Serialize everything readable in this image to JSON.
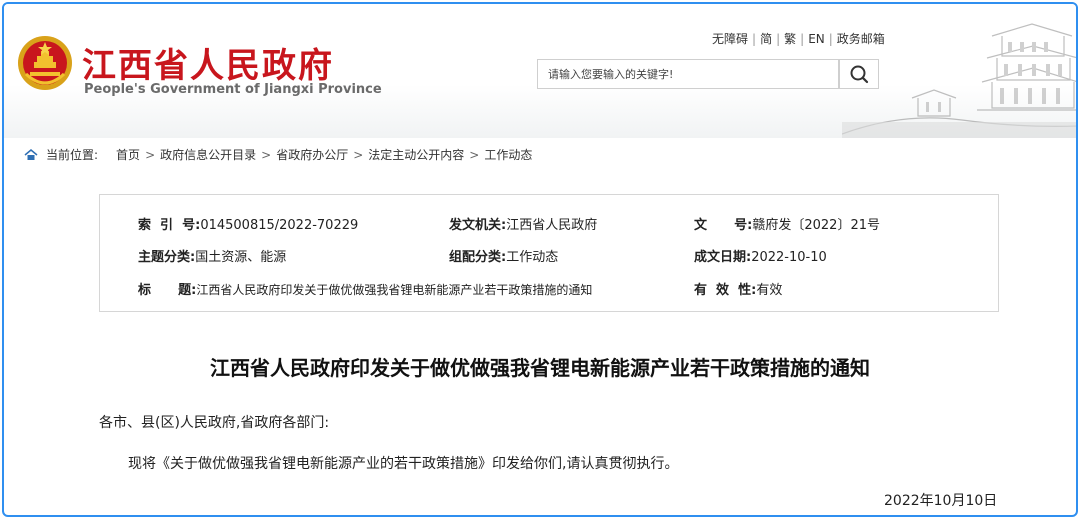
{
  "header": {
    "title_cn": "江西省人民政府",
    "title_en": "People's Government of Jiangxi Province",
    "links": [
      "无障碍",
      "简",
      "繁",
      "EN",
      "政务邮箱"
    ],
    "search": {
      "placeholder": "请输入您要输入的关键字!"
    },
    "emblem_icon": "national-emblem-icon",
    "search_icon": "magnifier-icon",
    "decoration": "tengwang-pavilion-illustration"
  },
  "breadcrumb": {
    "position_label": "当前位置:",
    "items": [
      "首页",
      "政府信息公开目录",
      "省政府办公厅",
      "法定主动公开内容",
      "工作动态"
    ]
  },
  "info": {
    "index_label": "索  引  号:",
    "index_value": "014500815/2022-70229",
    "issuer_label": "发文机关:",
    "issuer_value": "江西省人民政府",
    "docno_label": "文      号:",
    "docno_value": "赣府发〔2022〕21号",
    "topic_label": "主题分类:",
    "topic_value": "国土资源、能源",
    "category_label": "组配分类:",
    "category_value": "工作动态",
    "date_label": "成文日期:",
    "date_value": "2022-10-10",
    "title_label": "标      题:",
    "title_value": "江西省人民政府印发关于做优做强我省锂电新能源产业若干政策措施的通知",
    "validity_label": "有  效  性:",
    "validity_value": "有效"
  },
  "article": {
    "title": "江西省人民政府印发关于做优做强我省锂电新能源产业若干政策措施的通知",
    "salutation": "各市、县(区)人民政府,省政府各部门:",
    "body": "现将《关于做优做强我省锂电新能源产业的若干政策措施》印发给你们,请认真贯彻执行。",
    "date": "2022年10月10日"
  },
  "colors": {
    "brand_red": "#c8161d",
    "frame_blue": "#2f8ff0"
  }
}
